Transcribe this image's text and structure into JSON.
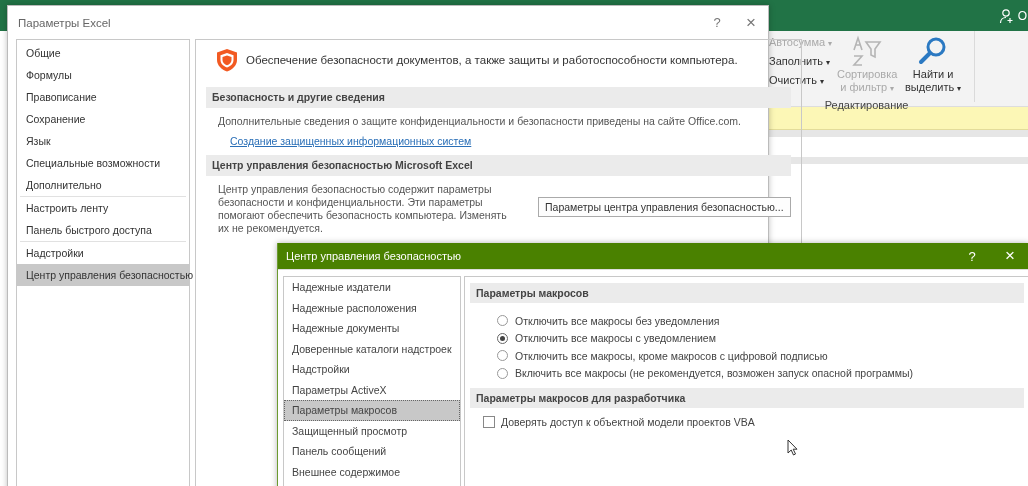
{
  "excel": {
    "account": "О",
    "ribbon": {
      "group_label": "Редактирование",
      "buttons": [
        {
          "label": "Автосумма",
          "caret": "▾",
          "disabled": true,
          "kind": "small"
        },
        {
          "label": "Заполнить",
          "caret": "▾",
          "disabled": false,
          "kind": "small"
        },
        {
          "label": "Очистить",
          "caret": "▾",
          "disabled": false,
          "kind": "small"
        },
        {
          "label": "Сортировка и фильтр",
          "caret": "▾",
          "disabled": true,
          "kind": "large"
        },
        {
          "label": "Найти и выделить",
          "caret": "▾",
          "disabled": false,
          "kind": "large"
        }
      ]
    }
  },
  "options_window": {
    "title": "Параметры Excel",
    "help": "?",
    "close": "×",
    "nav_groups": [
      [
        {
          "label": "Общие",
          "selected": false
        },
        {
          "label": "Формулы",
          "selected": false
        },
        {
          "label": "Правописание",
          "selected": false
        },
        {
          "label": "Сохранение",
          "selected": false
        },
        {
          "label": "Язык",
          "selected": false
        },
        {
          "label": "Специальные возможности",
          "selected": false
        },
        {
          "label": "Дополнительно",
          "selected": false
        }
      ],
      [
        {
          "label": "Настроить ленту",
          "selected": false
        },
        {
          "label": "Панель быстрого доступа",
          "selected": false
        }
      ],
      [
        {
          "label": "Надстройки",
          "selected": false
        },
        {
          "label": "Центр управления безопасностью",
          "selected": true
        }
      ]
    ],
    "heading": "Обеспечение безопасности документов, а также защиты и работоспособности компьютера.",
    "privacy_section": {
      "title": "Безопасность и другие сведения",
      "text": "Дополнительные сведения о защите конфиденциальности и безопасности приведены на сайте Office.com.",
      "link": "Создание защищенных информационных систем"
    },
    "trust_section": {
      "title": "Центр управления безопасностью Microsoft Excel",
      "text": "Центр управления безопасностью содержит параметры безопасности и конфиденциальности. Эти параметры помогают обеспечить безопасность компьютера. Изменять их не рекомендуется.",
      "button": "Параметры центра управления безопасностью..."
    }
  },
  "trust_center": {
    "title": "Центр управления безопасностью",
    "help": "?",
    "close": "×",
    "nav": [
      {
        "label": "Надежные издатели",
        "selected": false
      },
      {
        "label": "Надежные расположения",
        "selected": false
      },
      {
        "label": "Надежные документы",
        "selected": false
      },
      {
        "label": "Доверенные каталоги надстроек",
        "selected": false
      },
      {
        "label": "Надстройки",
        "selected": false
      },
      {
        "label": "Параметры ActiveX",
        "selected": false
      },
      {
        "label": "Параметры макросов",
        "selected": true
      },
      {
        "label": "Защищенный просмотр",
        "selected": false
      },
      {
        "label": "Панель сообщений",
        "selected": false
      },
      {
        "label": "Внешнее содержимое",
        "selected": false
      }
    ],
    "macro_section": {
      "title": "Параметры макросов",
      "options": [
        {
          "label": "Отключить все макросы без уведомления",
          "selected": false
        },
        {
          "label": "Отключить все макросы с уведомлением",
          "selected": true
        },
        {
          "label": "Отключить все макросы, кроме макросов с цифровой подписью",
          "selected": false
        },
        {
          "label": "Включить все макросы (не рекомендуется, возможен запуск опасной программы)",
          "selected": false
        }
      ]
    },
    "developer_section": {
      "title": "Параметры макросов для разработчика",
      "checkbox": {
        "label": "Доверять доступ к объектной модели проектов VBA",
        "checked": false
      }
    }
  }
}
